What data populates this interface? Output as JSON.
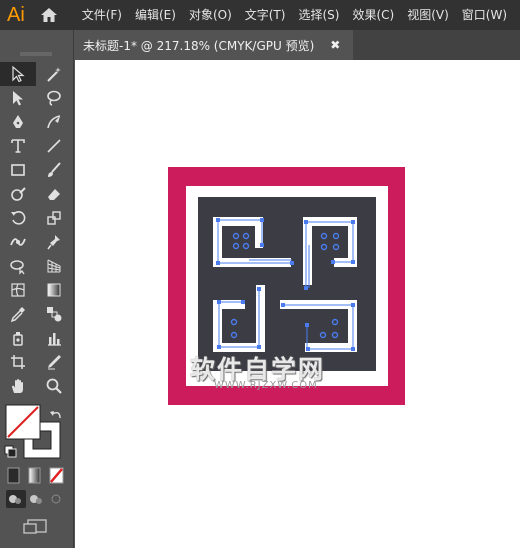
{
  "app": {
    "logo": "Ai"
  },
  "menubar": {
    "items": [
      "文件(F)",
      "编辑(E)",
      "对象(O)",
      "文字(T)",
      "选择(S)",
      "效果(C)",
      "视图(V)",
      "窗口(W)"
    ]
  },
  "toolbar": {
    "collapse_glyph": "◂◂"
  },
  "document_tab": {
    "title": "未标题-1* @ 217.18% (CMYK/GPU 预览)",
    "close_glyph": "✖"
  },
  "colors": {
    "frame": "#cc1c5c",
    "mat": "#ffffff",
    "panel": "#3c3c44",
    "selection": "#4a7cf0"
  },
  "watermark": {
    "main": "软件自学网",
    "sub": "WWW.RJZXW.COM"
  }
}
